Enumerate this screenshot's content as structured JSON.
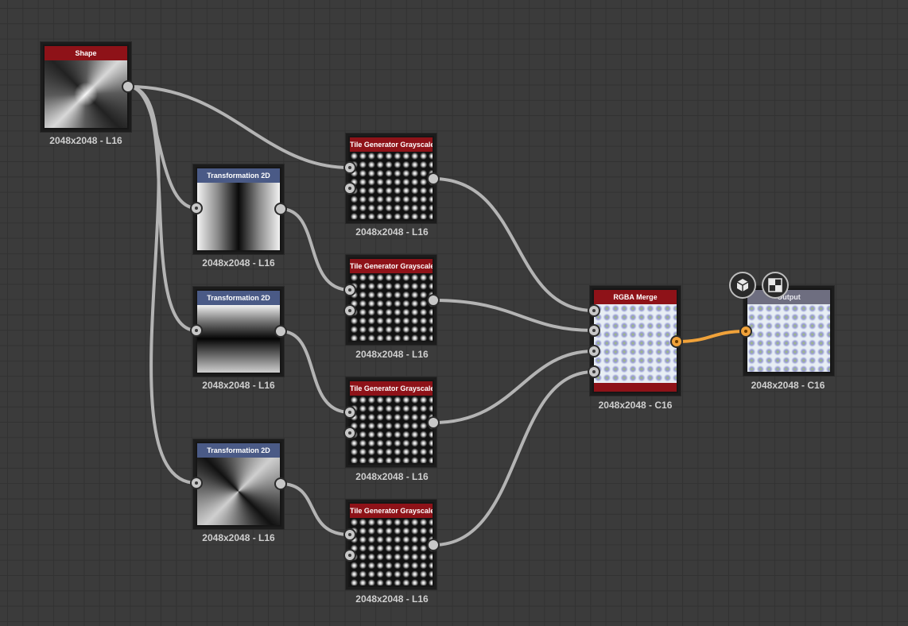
{
  "graph": {
    "nodes": {
      "shape": {
        "title": "Shape",
        "label": "2048x2048 - L16"
      },
      "transform_1": {
        "title": "Transformation 2D",
        "label": "2048x2048 - L16"
      },
      "transform_2": {
        "title": "Transformation 2D",
        "label": "2048x2048 - L16"
      },
      "transform_3": {
        "title": "Transformation 2D",
        "label": "2048x2048 - L16"
      },
      "tile_1": {
        "title": "Tile Generator Grayscale",
        "label": "2048x2048 - L16"
      },
      "tile_2": {
        "title": "Tile Generator Grayscale",
        "label": "2048x2048 - L16"
      },
      "tile_3": {
        "title": "Tile Generator Grayscale",
        "label": "2048x2048 - L16"
      },
      "tile_4": {
        "title": "Tile Generator Grayscale",
        "label": "2048x2048 - L16"
      },
      "rgba_merge": {
        "title": "RGBA Merge",
        "label": "2048x2048 - C16"
      },
      "output": {
        "title": "Output",
        "label": "2048x2048 - C16"
      }
    },
    "output_buttons": [
      "3d-view-icon",
      "2d-view-icon"
    ]
  },
  "colors": {
    "canvas": "#3b3b3b",
    "grid": "#323232",
    "header_red": "#8e1218",
    "header_blue": "#4a5a86",
    "header_output": "#6e6e80",
    "wire": "#b4b4b4",
    "wire_active": "#f0a23a"
  }
}
